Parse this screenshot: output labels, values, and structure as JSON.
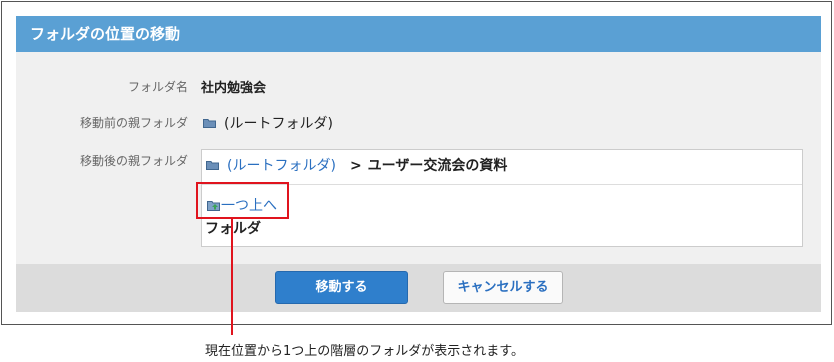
{
  "dialog": {
    "title": "フォルダの位置の移動"
  },
  "fields": {
    "folder_name_label": "フォルダ名",
    "folder_name_value": "社内勉強会",
    "current_parent_label": "移動前の親フォルダ",
    "current_parent_value": "(ルートフォルダ)",
    "new_parent_label": "移動後の親フォルダ"
  },
  "destination": {
    "root_link": "(ルートフォルダ)",
    "separator": ">",
    "current_folder": "ユーザー交流会の資料",
    "up_link": "一つ上へ",
    "folder_heading": "フォルダ"
  },
  "buttons": {
    "move": "移動する",
    "cancel": "キャンセルする"
  },
  "annotation": {
    "caption": "現在位置から1つ上の階層のフォルダが表示されます。",
    "color": "#e0141e"
  },
  "colors": {
    "header": "#5aa0d4",
    "primary_button": "#2f7fcc",
    "link": "#2a6fc0"
  },
  "icons": {
    "folder": "folder-icon",
    "folder_up": "folder-up-icon"
  }
}
